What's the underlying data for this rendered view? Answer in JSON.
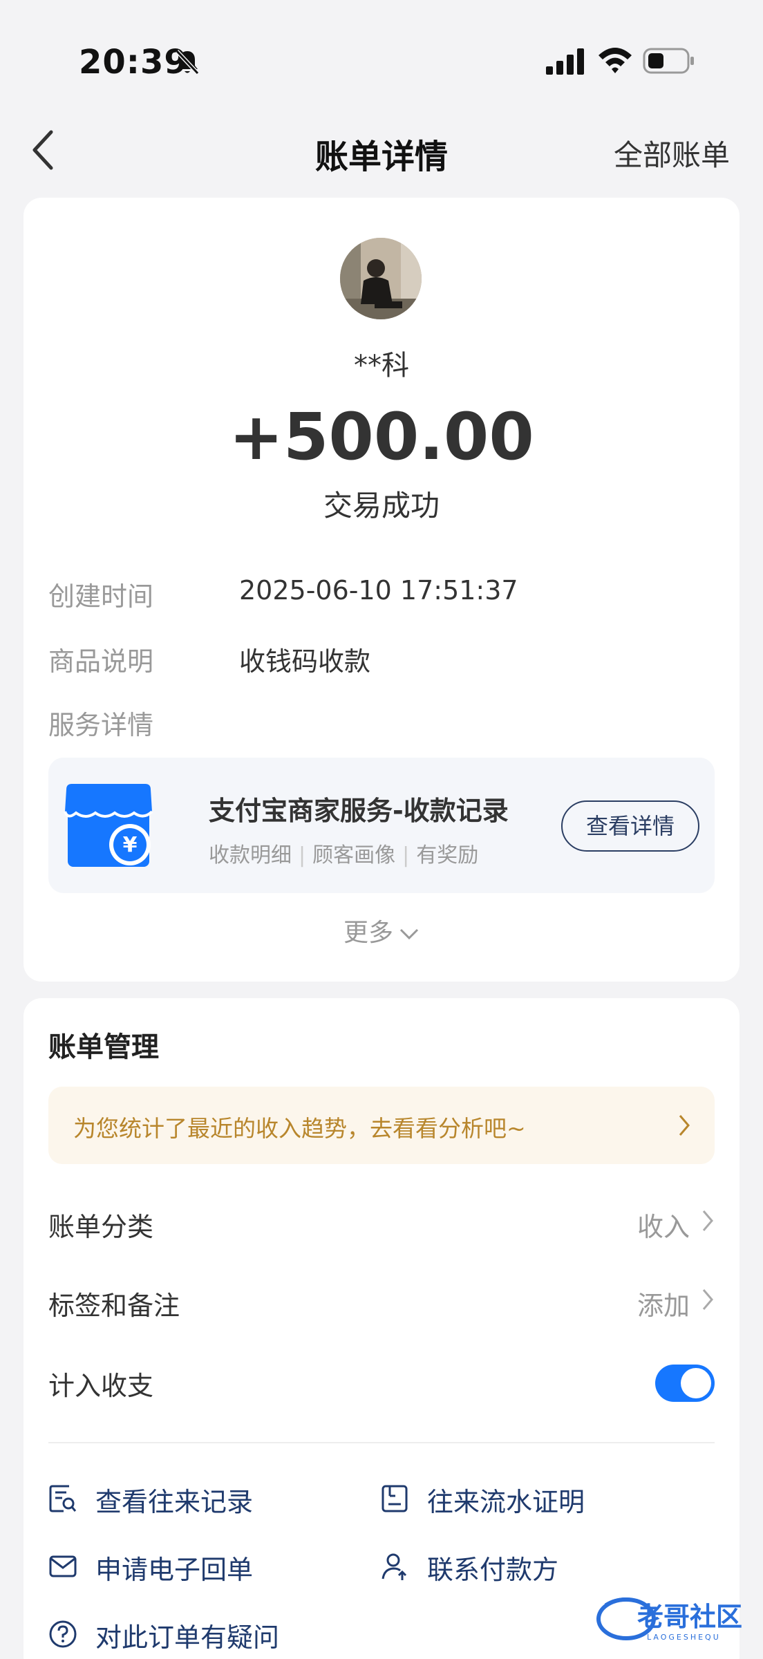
{
  "status_bar": {
    "time": "20:39"
  },
  "nav": {
    "title": "账单详情",
    "right_link": "全部账单"
  },
  "transaction": {
    "payer_name": "**科",
    "amount": "+500.00",
    "status": "交易成功",
    "rows": [
      {
        "label": "创建时间",
        "value": "2025-06-10 17:51:37"
      },
      {
        "label": "商品说明",
        "value": "收钱码收款"
      },
      {
        "label": "服务详情",
        "value": ""
      }
    ],
    "service": {
      "title": "支付宝商家服务-收款记录",
      "tags": [
        "收款明细",
        "顾客画像",
        "有奖励"
      ],
      "button": "查看详情",
      "icon_symbol": "¥"
    },
    "more_label": "更多"
  },
  "management": {
    "title": "账单管理",
    "banner": "为您统计了最近的收入趋势，去看看分析吧~",
    "category": {
      "label": "账单分类",
      "value": "收入"
    },
    "tags_notes": {
      "label": "标签和备注",
      "value": "添加"
    },
    "count_in": {
      "label": "计入收支",
      "enabled": true
    },
    "actions": [
      {
        "label": "查看往来记录",
        "icon": "record-search-icon"
      },
      {
        "label": "往来流水证明",
        "icon": "statement-icon"
      },
      {
        "label": "申请电子回单",
        "icon": "mail-icon"
      },
      {
        "label": "联系付款方",
        "icon": "contact-payer-icon"
      },
      {
        "label": "对此订单有疑问",
        "icon": "question-icon"
      }
    ]
  },
  "watermark": {
    "text": "老哥社区",
    "subtext": "LAOGESHEQU"
  },
  "colors": {
    "accent": "#1677ff",
    "link_navy": "#1f3a6d",
    "banner_text": "#b8862c",
    "background": "#f3f3f5"
  }
}
